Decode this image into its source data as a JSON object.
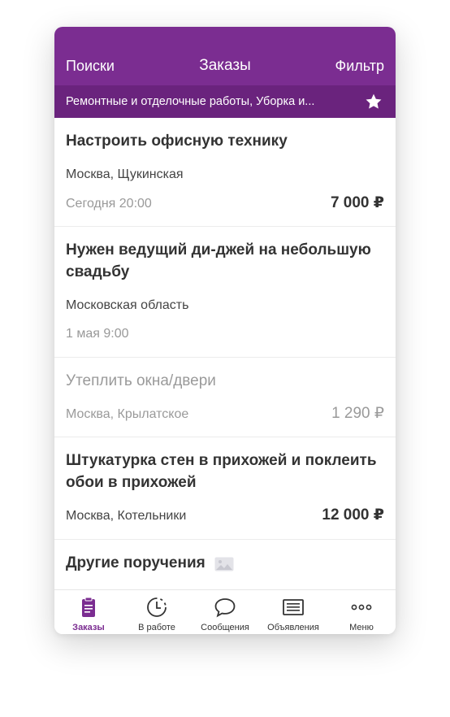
{
  "colors": {
    "accent": "#7b2d91",
    "filter_bar": "#6a237d"
  },
  "header": {
    "left_label": "Поиски",
    "title": "Заказы",
    "right_label": "Фильтр"
  },
  "filter": {
    "text": "Ремонтные и отделочные работы, Уборка и...",
    "icon": "star-icon"
  },
  "orders": [
    {
      "title": "Настроить офисную технику",
      "location": "Москва, Щукинская",
      "date": "Сегодня 20:00",
      "price": "7 000 ₽"
    },
    {
      "title": "Нужен ведущий ди-джей на небольшую свадьбу",
      "location": "Московская область",
      "date": "1 мая 9:00"
    },
    {
      "title": "Утеплить окна/двери",
      "location": "Москва, Крылатское",
      "price": "1 290 ₽"
    },
    {
      "title": "Штукатурка стен в прихожей и поклеить обои в прихожей",
      "location": "Москва, Котельники",
      "price": "12 000 ₽"
    },
    {
      "title": "Другие поручения",
      "icon": "image-icon"
    }
  ],
  "tabs": [
    {
      "label": "Заказы",
      "icon": "clipboard-icon",
      "active": true
    },
    {
      "label": "В работе",
      "icon": "clock-icon"
    },
    {
      "label": "Сообщения",
      "icon": "chat-bubble-icon"
    },
    {
      "label": "Объявления",
      "icon": "newspaper-icon"
    },
    {
      "label": "Меню",
      "icon": "more-dots-icon"
    }
  ]
}
